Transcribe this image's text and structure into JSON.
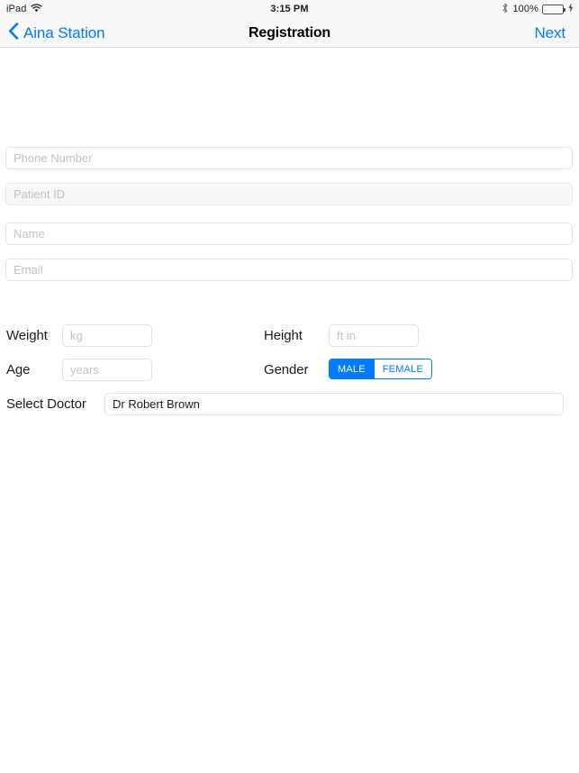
{
  "status_bar": {
    "device": "iPad",
    "wifi_icon": "wifi-icon",
    "time": "3:15 PM",
    "bluetooth_icon": "bluetooth-icon",
    "battery_percent": "100%",
    "battery_icon": "battery-full-icon",
    "charging_icon": "lightning-bolt-icon",
    "battery_color": "#4cd764"
  },
  "nav_bar": {
    "back_icon": "chevron-left-icon",
    "back_label": "Aina Station",
    "title": "Registration",
    "next_label": "Next",
    "accent_color": "#007aff"
  },
  "form": {
    "phone": {
      "placeholder": "Phone Number",
      "value": ""
    },
    "patient_id": {
      "placeholder": "Patient ID",
      "value": ""
    },
    "name": {
      "placeholder": "Name",
      "value": ""
    },
    "email": {
      "placeholder": "Email",
      "value": ""
    },
    "weight": {
      "label": "Weight",
      "placeholder": "kg",
      "value": ""
    },
    "height": {
      "label": "Height",
      "placeholder": "ft in",
      "value": ""
    },
    "age": {
      "label": "Age",
      "placeholder": "years",
      "value": ""
    },
    "gender": {
      "label": "Gender",
      "options": [
        "MALE",
        "FEMALE"
      ],
      "selected": "MALE"
    },
    "doctor": {
      "label": "Select Doctor",
      "placeholder": "",
      "value": "Dr Robert Brown"
    }
  }
}
